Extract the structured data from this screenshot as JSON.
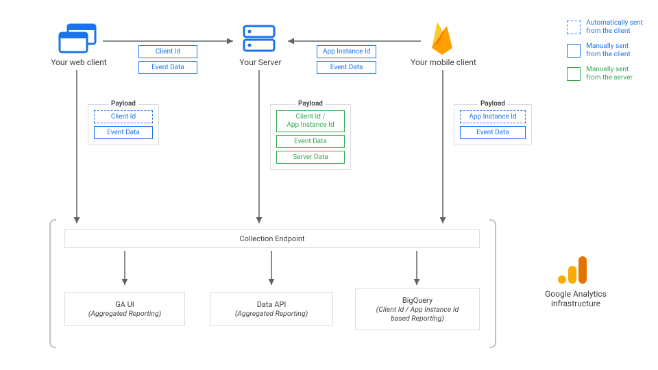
{
  "nodes": {
    "web": "Your web client",
    "server": "Your Server",
    "mobile": "Your mobile client"
  },
  "client_tags": {
    "web_to_server": {
      "a": "Client Id",
      "b": "Event Data"
    },
    "mobile_to_server": {
      "a": "App Instance Id",
      "b": "Event Data"
    }
  },
  "payloads": {
    "title": "Payload",
    "web": {
      "a": "Client Id",
      "b": "Event Data"
    },
    "server": {
      "a": "Client Id /\nApp Instance Id",
      "b": "Event Data",
      "c": "Server Data"
    },
    "mobile": {
      "a": "App Instance Id",
      "b": "Event Data"
    }
  },
  "infra": {
    "collection": "Collection Endpoint",
    "ga_ui": {
      "t": "GA UI",
      "s": "(Aggregated Reporting)"
    },
    "data_api": {
      "t": "Data API",
      "s": "(Aggregated Reporting)"
    },
    "bigquery": {
      "t": "BigQuery",
      "s": "(Client Id / App Instance Id\nbased Reporting)"
    },
    "label": "Google Analytics\ninfrastructure"
  },
  "legend": {
    "auto": "Automatically sent\nfrom the client",
    "manual_client": "Manually sent\nfrom the client",
    "manual_server": "Manually sent\nfrom the server"
  }
}
